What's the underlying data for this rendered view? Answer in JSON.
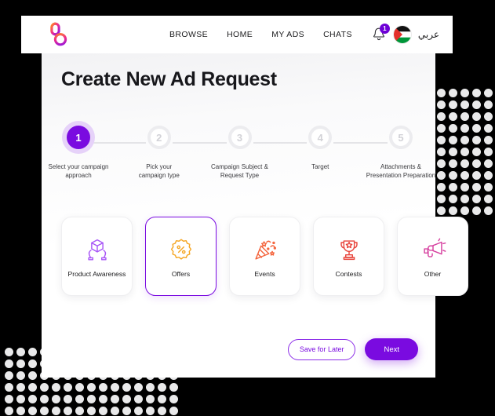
{
  "navbar": {
    "logo_name": "brand-logo",
    "links": [
      {
        "label": "BROWSE"
      },
      {
        "label": "HOME"
      },
      {
        "label": "MY ADS"
      },
      {
        "label": "CHATS"
      }
    ],
    "notifications": {
      "icon": "bell-icon",
      "count": "1"
    },
    "language": {
      "flag": "palestine-flag-icon",
      "label": "عربي"
    }
  },
  "page": {
    "title": "Create New Ad Request"
  },
  "stepper": {
    "current_step": 1,
    "steps": [
      {
        "number": "1",
        "label": "Select your campaign\napproach",
        "state": "done"
      },
      {
        "number": "2",
        "label": "Pick your\ncampaign type",
        "state": "todo"
      },
      {
        "number": "3",
        "label": "Campaign Subject &\nRequest Type",
        "state": "todo"
      },
      {
        "number": "4",
        "label": "Target",
        "state": "todo"
      },
      {
        "number": "5",
        "label": "Attachments &\nPresentation Preparation",
        "state": "todo"
      }
    ]
  },
  "categories": {
    "selected": "Offers",
    "items": [
      {
        "label": "Product Awareness",
        "icon": "package-hands-icon",
        "color": "#a855f7",
        "selected": false
      },
      {
        "label": "Offers",
        "icon": "percent-badge-icon",
        "color": "#f5a623",
        "selected": true
      },
      {
        "label": "Events",
        "icon": "party-popper-icon",
        "color": "#f4623a",
        "selected": false
      },
      {
        "label": "Contests",
        "icon": "trophy-icon",
        "color": "#e8453c",
        "selected": false
      },
      {
        "label": "Other",
        "icon": "megaphone-icon",
        "color": "#d6409f",
        "selected": false
      }
    ]
  },
  "actions": {
    "save_label": "Save for Later",
    "next_label": "Next"
  },
  "colors": {
    "accent_purple": "#7a0be0",
    "badge_purple": "#6d00d6",
    "page_background": "#000000",
    "card_background": "#ffffff",
    "dot_pattern": "#e9e9ea"
  }
}
